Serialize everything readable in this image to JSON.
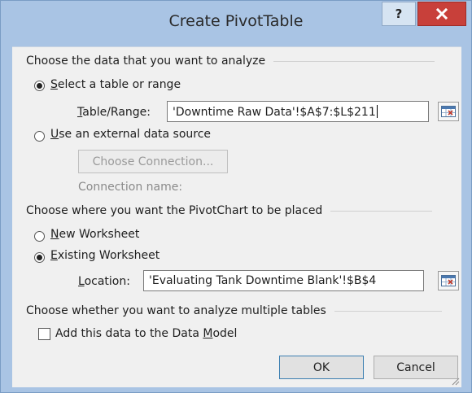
{
  "dialog": {
    "title": "Create PivotTable",
    "help_label": "?"
  },
  "data_section": {
    "heading": "Choose the data that you want to analyze",
    "select_range": {
      "label_key": "S",
      "label_rest": "elect a table or range",
      "checked": true
    },
    "table_range": {
      "label_key": "T",
      "label_rest": "able/Range:",
      "value": "'Downtime Raw Data'!$A$7:$L$211"
    },
    "external": {
      "label_key": "U",
      "label_rest": "se an external data source",
      "checked": false
    },
    "choose_connection_label": "Choose Connection...",
    "connection_name_label": "Connection name:"
  },
  "placement_section": {
    "heading": "Choose where you want the PivotChart to be placed",
    "new_worksheet": {
      "label_key": "N",
      "label_rest": "ew Worksheet",
      "checked": false
    },
    "existing_worksheet": {
      "label_key": "E",
      "label_rest": "xisting Worksheet",
      "checked": true
    },
    "location": {
      "label_key": "L",
      "label_rest": "ocation:",
      "value": "'Evaluating Tank Downtime Blank'!$B$4"
    }
  },
  "tables_section": {
    "heading": "Choose whether you want to analyze multiple tables",
    "data_model": {
      "label_pre": "Add this data to the Data ",
      "label_key": "M",
      "label_post": "odel",
      "checked": false
    }
  },
  "buttons": {
    "ok_label": "OK",
    "cancel_label": "Cancel"
  },
  "colors": {
    "frame": "#a9c4e4",
    "close": "#c8403a",
    "client": "#f0f0f0"
  }
}
